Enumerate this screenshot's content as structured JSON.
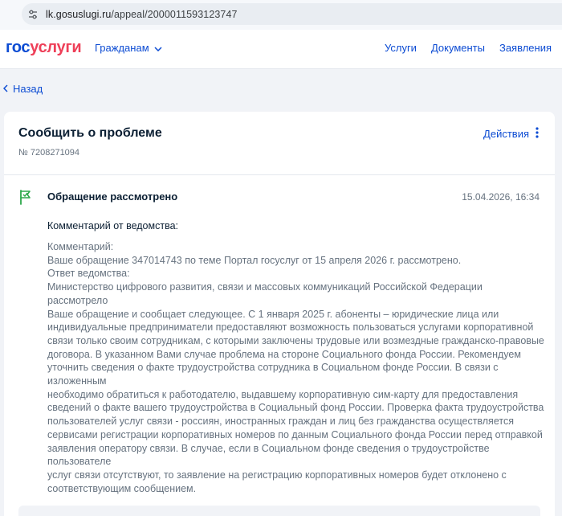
{
  "browser": {
    "url_host": "lk.gosuslugi.ru",
    "url_path": "/appeal/2000011593123747"
  },
  "header": {
    "logo_part1": "гос",
    "logo_part2": "услуги",
    "audience_label": "Гражданам",
    "nav": [
      "Услуги",
      "Документы",
      "Заявления"
    ]
  },
  "back_label": "Назад",
  "card": {
    "title": "Сообщить о проблеме",
    "number": "№ 7208271094",
    "actions_label": "Действия",
    "status": {
      "title": "Обращение рассмотрено",
      "date": "15.04.2026, 16:34"
    },
    "dept_comment_label": "Комментарий от ведомства:",
    "comment_lines": [
      "Комментарий:",
      "Ваше обращение 347014743 по теме Портал госуслуг от 15 апреля 2026 г. рассмотрено.",
      "Ответ ведомства:",
      "Министерство цифрового развития, связи и массовых коммуникаций Российской Федерации рассмотрело",
      "Ваше обращение и сообщает следующее. С 1 января 2025 г. абоненты – юридические лица или",
      "индивидуальные предприниматели предоставляют возможность пользоваться услугами корпоративной",
      "связи только своим сотрудникам, с которыми заключены трудовые или возмездные гражданско-правовые",
      "договора. В указанном Вами случае проблема на стороне Социального фонда России. Рекомендуем",
      "уточнить сведения о факте трудоустройства сотрудника в Социальном фонде России. В связи с изложенным",
      "необходимо обратиться к работодателю, выдавшему корпоративную сим-карту для предоставления",
      "сведений о факте вашего трудоустройства в Социальный фонд России. Проверка факта трудоустройства",
      "пользователей услуг связи - россиян, иностранных граждан и лиц без гражданства осуществляется",
      "сервисами регистрации корпоративных номеров по данным Социального фонда России перед отправкой",
      "заявления оператору связи. В случае, если в Социальном фонде сведения о трудоустройстве пользователе",
      "услуг связи отсутствуют, то заявление на регистрацию корпоративных номеров будет отклонено с",
      "соответствующим сообщением."
    ]
  },
  "colors": {
    "brand_blue": "#0d4cd3",
    "brand_red": "#ee3f58",
    "status_green": "#2ea84b",
    "text_dark": "#0b1f33",
    "text_muted": "#66727f",
    "page_bg": "#f1f3f7"
  }
}
